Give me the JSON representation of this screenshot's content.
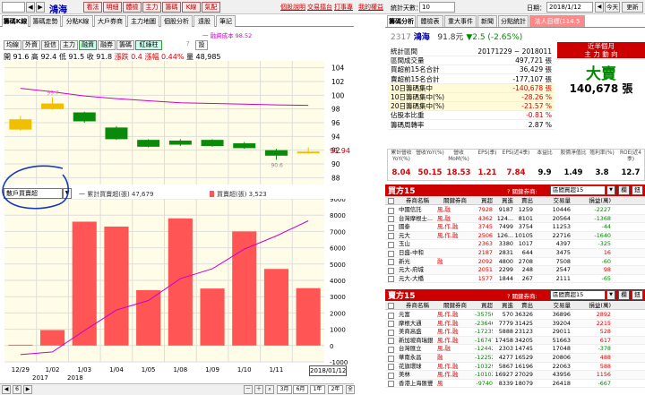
{
  "toolbar": {
    "code_value": "",
    "name": "鴻海",
    "buttons": [
      "看法",
      "明細",
      "體檢",
      "主力",
      "籌碼",
      "K線",
      "氣配"
    ],
    "links": [
      "個股說明",
      "交易擂台",
      "打事專",
      "我的權益"
    ],
    "days_label": "統計天數：",
    "days_value": "10",
    "date_label": "日期：",
    "date_value": "2018/1/12",
    "today": "今天",
    "refresh": "更新"
  },
  "left_tabs": [
    "籌碼K線",
    "籌碼走勢",
    "分點K線",
    "大戶券商",
    "主力地圖",
    "個股分析",
    "遠股",
    "筆記"
  ],
  "indicators": [
    "均線",
    "外資",
    "投信",
    "主力",
    "融資",
    "融券",
    "籌碼",
    "紅綠柱"
  ],
  "legend_ma": "一 融資成本 98.52",
  "ohlc": {
    "open_label": "開",
    "open": "91.6",
    "high_label": "高",
    "high": "92.4",
    "low_label": "低",
    "low": "91.5",
    "close_label": "收",
    "close": "91.8",
    "chg_label": "漲跌",
    "chg": "0.4",
    "pct_label": "漲幅",
    "pct": "0.44%",
    "vol_label": "量",
    "vol": "48,985"
  },
  "price_axis": [
    "104",
    "102",
    "100",
    "98",
    "96",
    "94",
    "92",
    "90",
    "88"
  ],
  "current_price": "91.94",
  "price_high_label": "99.7",
  "price_low_label": "90.6",
  "sub_select": "散戶買賣超",
  "sub_legend_1": "一 累計買賣超(張) 47,679",
  "sub_legend_2": "買賣超(張) 3,523",
  "sub_axis": [
    "9000",
    "8000",
    "7000",
    "6000",
    "5000",
    "4000",
    "3000",
    "2000",
    "1000",
    "0",
    "-1000"
  ],
  "dates": [
    "12/29",
    "1/02",
    "1/03",
    "1/04",
    "1/05",
    "1/08",
    "1/09",
    "1/10",
    "1/11"
  ],
  "year_labels": [
    "2017",
    "2018"
  ],
  "date_badge": "2018/01/12",
  "bottom_buttons": [
    "3月",
    "6月",
    "1年",
    "2年",
    "全部",
    "放大"
  ],
  "page_num": "6",
  "right_tabs": [
    "籌碼分析",
    "體檢表",
    "重大事件",
    "新聞",
    "分點統計",
    "法人目標(114.5元)"
  ],
  "stock": {
    "code": "2317",
    "name": "鴻海",
    "price": "91.8元",
    "chg": "▼2.5 (-2.65%)"
  },
  "stats": [
    {
      "label": "統計區間",
      "value": "20171229 ~ 2018011"
    },
    {
      "label": "區間成交量",
      "value": "497,721 張"
    },
    {
      "label": "買超前15名合計",
      "value": "36,429 張"
    },
    {
      "label": "賣超前15名合計",
      "value": "-177,107 張"
    },
    {
      "label": "10日籌碼集中",
      "value": "-140,678 張"
    },
    {
      "label": "10日籌碼集中(%)",
      "value": "-28.26 %"
    },
    {
      "label": "20日籌碼集中(%)",
      "value": "-21.57 %"
    },
    {
      "label": "佔股本比重",
      "value": "-0.81 %"
    },
    {
      "label": "籌碼周轉率",
      "value": "2.87 %"
    }
  ],
  "big": {
    "head1": "近半個月",
    "head2": "主 力 動 向",
    "label": "大賣",
    "value": "140,678 張"
  },
  "metrics_head": [
    "累計營收YoY(%)",
    "營收YoY(%)",
    "營收MoM(%)",
    "EPS(季)",
    "EPS(近4季)",
    "本益比",
    "股價淨值比",
    "殖利率(%)",
    "ROE(近4季)"
  ],
  "metrics_val": [
    "8.04",
    "50.15",
    "18.53",
    "1.21",
    "7.84",
    "9.9",
    "1.49",
    "3.8",
    "12.7"
  ],
  "buy_title": "買方15",
  "sell_title": "賣方15",
  "filter_label": "關鍵券商:",
  "filter_value": "區間買超15",
  "filter_value2": "區間賣超15",
  "btn1": "欄",
  "btn2": "鈕",
  "cols": [
    "券商名稱",
    "關鍵券商",
    "買超",
    "買進",
    "賣出",
    "交易量",
    "損益(萬)"
  ],
  "buy_rows": [
    [
      "中國信託",
      "風,融",
      "7928",
      "9187",
      "1259",
      "10446",
      "-2227"
    ],
    [
      "台灣摩根士...",
      "風,融",
      "4362",
      "124...",
      "8101",
      "20564",
      "-1368"
    ],
    [
      "國泰",
      "風,作,融",
      "3745",
      "7499",
      "3754",
      "11253",
      "-44"
    ],
    [
      "元大",
      "風,作,融",
      "2506",
      "126...",
      "10105",
      "22716",
      "-1640"
    ],
    [
      "玉山",
      "",
      "2363",
      "3380",
      "1017",
      "4397",
      "-325"
    ],
    [
      "日盛-中和",
      "",
      "2187",
      "2831",
      "644",
      "3475",
      "16"
    ],
    [
      "新光",
      "融",
      "2092",
      "4800",
      "2708",
      "7508",
      "-60"
    ],
    [
      "元大-府城",
      "",
      "2051",
      "2299",
      "248",
      "2547",
      "98"
    ],
    [
      "元大-大橋",
      "",
      "1577",
      "1844",
      "267",
      "2111",
      "-65"
    ]
  ],
  "sell_rows": [
    [
      "元富",
      "風,作,融",
      "-35756",
      "570",
      "36326",
      "36896",
      "2892"
    ],
    [
      "摩根大通",
      "風,作,融",
      "-23646",
      "7779",
      "31425",
      "39204",
      "2215"
    ],
    [
      "美商高盛",
      "風,作,融",
      "-17235",
      "5888",
      "23123",
      "29011",
      "528"
    ],
    [
      "新加坡商瑞銀",
      "風,作,融",
      "-16747",
      "17458",
      "34205",
      "51663",
      "617"
    ],
    [
      "台灣匯立",
      "風,融",
      "-12442",
      "2303",
      "14745",
      "17048",
      "-378"
    ],
    [
      "華南永昌",
      "融",
      "-12252",
      "4277",
      "16529",
      "20806",
      "488"
    ],
    [
      "花旗環球",
      "風,作,融",
      "-10329",
      "5867",
      "16196",
      "22063",
      "588"
    ],
    [
      "美林",
      "風,作,融",
      "-10102",
      "16927",
      "27029",
      "43956",
      "1156"
    ],
    [
      "香港上海匯豐",
      "風",
      "-9740",
      "8339",
      "18079",
      "26418",
      "-667"
    ]
  ],
  "chart_data": [
    {
      "type": "candlestick",
      "x": [
        "12/29",
        "1/02",
        "1/03",
        "1/04",
        "1/05",
        "1/08",
        "1/09",
        "1/10",
        "1/11",
        "1/12"
      ],
      "open": [
        95.0,
        98.0,
        97.5,
        95.3,
        93.5,
        93.4,
        93.5,
        93.0,
        92.0,
        91.6
      ],
      "close": [
        96.5,
        98.8,
        96.2,
        93.6,
        92.5,
        92.8,
        92.6,
        92.3,
        91.2,
        91.8
      ],
      "high": [
        97.0,
        99.7,
        97.6,
        95.5,
        93.6,
        93.6,
        93.6,
        93.2,
        92.2,
        92.4
      ],
      "low": [
        94.8,
        97.9,
        96.0,
        93.5,
        92.4,
        92.6,
        92.5,
        92.2,
        90.6,
        91.5
      ],
      "ma_line": [
        101.0,
        100.5,
        99.9,
        99.5,
        99.2,
        98.9,
        98.8,
        98.7,
        98.6,
        98.52
      ],
      "ylim": [
        87,
        105
      ]
    },
    {
      "type": "bar",
      "x": [
        "12/29",
        "1/02",
        "1/03",
        "1/04",
        "1/05",
        "1/08",
        "1/09",
        "1/10",
        "1/11",
        "1/12"
      ],
      "values": [
        50,
        950,
        7600,
        7300,
        3400,
        7800,
        3500,
        7000,
        4700,
        3523
      ],
      "line": [
        50,
        1000,
        8600,
        15900,
        19300,
        27100,
        30600,
        37600,
        42300,
        47679
      ],
      "ylim": [
        -1000,
        9000
      ]
    }
  ]
}
